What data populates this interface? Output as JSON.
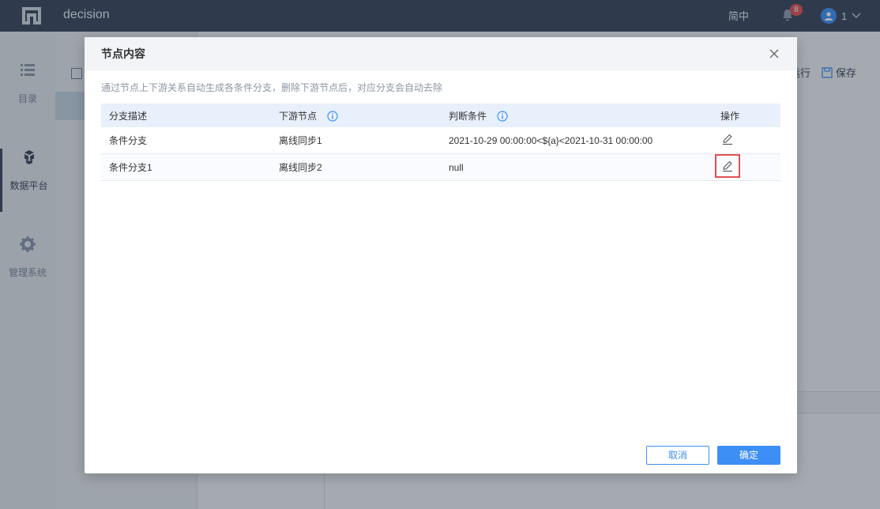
{
  "header": {
    "app_name": "decision",
    "language": "简中",
    "notification_count": "8",
    "user_name": "1"
  },
  "nav": {
    "items": [
      {
        "label": "目录",
        "icon": "list-icon"
      },
      {
        "label": "数据平台",
        "icon": "cubes-icon"
      },
      {
        "label": "管理系统",
        "icon": "gear-icon"
      }
    ]
  },
  "toolbar": {
    "run_label": "运行",
    "save_label": "保存"
  },
  "modal": {
    "title": "节点内容",
    "tip": "通过节点上下游关系自动生成各条件分支，删除下游节点后，对应分支会自动去除",
    "columns": [
      "分支描述",
      "下游节点",
      "判断条件",
      "操作"
    ],
    "rows": [
      {
        "desc": "条件分支",
        "node": "离线同步1",
        "condition": "2021-10-29 00:00:00<${a}<2021-10-31 00:00:00"
      },
      {
        "desc": "条件分支1",
        "node": "离线同步2",
        "condition": "null"
      }
    ],
    "cancel_label": "取消",
    "ok_label": "确定"
  },
  "colors": {
    "accent": "#3d8ff5",
    "header_bg": "#3a4659",
    "badge": "#e0504f",
    "highlight": "#e0504f"
  }
}
